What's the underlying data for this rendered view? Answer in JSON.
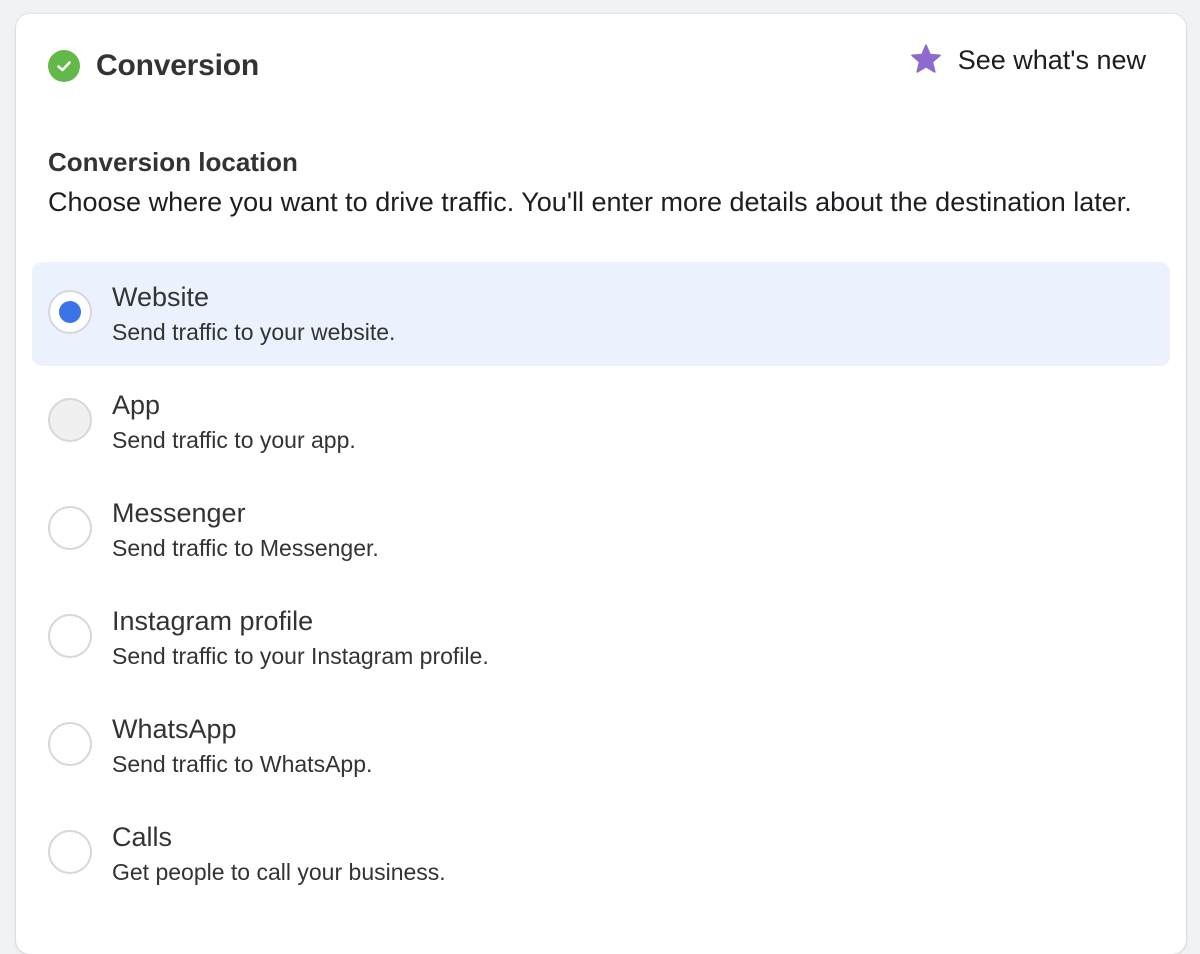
{
  "header": {
    "title": "Conversion",
    "whats_new_label": "See what's new",
    "status_color": "#63b84a",
    "star_color": "#8c6bd1"
  },
  "conversion_location": {
    "title": "Conversion location",
    "description": "Choose where you want to drive traffic. You'll enter more details about the destination later."
  },
  "options": [
    {
      "label": "Website",
      "description": "Send traffic to your website.",
      "selected": true
    },
    {
      "label": "App",
      "description": "Send traffic to your app.",
      "selected": false
    },
    {
      "label": "Messenger",
      "description": "Send traffic to Messenger.",
      "selected": false
    },
    {
      "label": "Instagram profile",
      "description": "Send traffic to your Instagram profile.",
      "selected": false
    },
    {
      "label": "WhatsApp",
      "description": "Send traffic to WhatsApp.",
      "selected": false
    },
    {
      "label": "Calls",
      "description": "Get people to call your business.",
      "selected": false
    }
  ]
}
